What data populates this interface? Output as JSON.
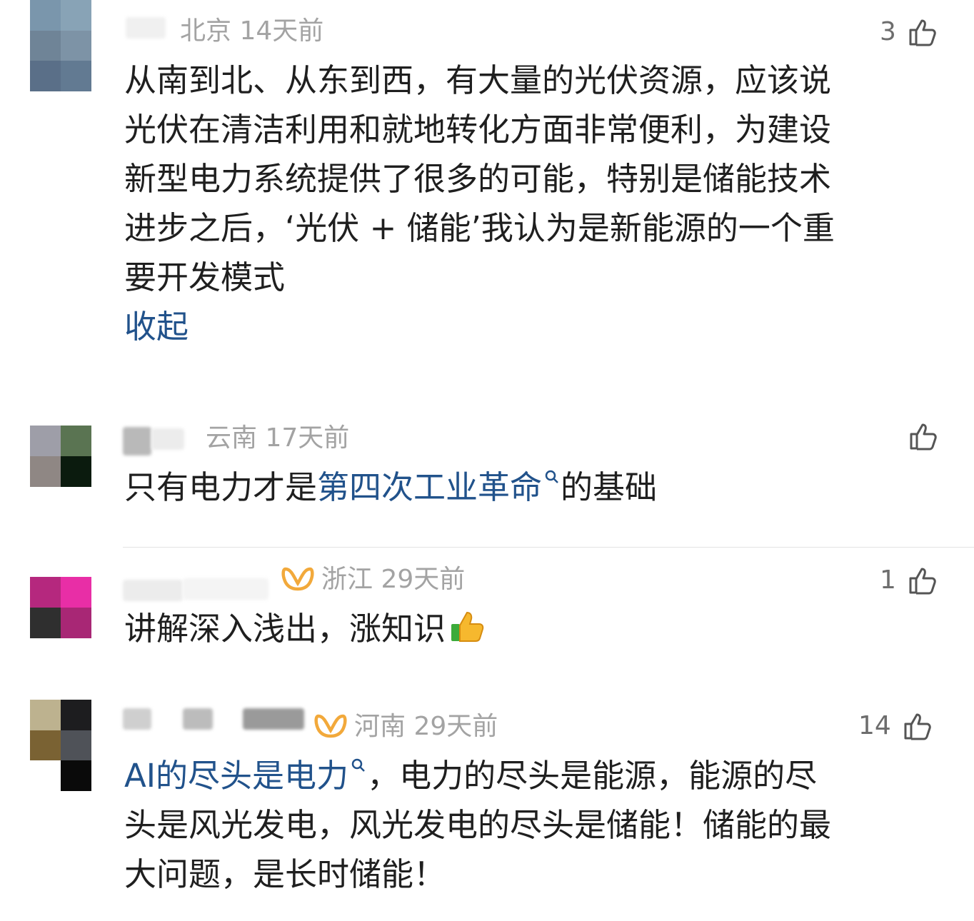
{
  "comments": [
    {
      "location_time": "北京 14天前",
      "likes": "3",
      "lines": [
        "从南到北、从东到西，有大量的光伏资源，应该说",
        "光伏在清洁利用和就地转化方面非常便利，为建设",
        "新型电力系统提供了很多的可能，特别是储能技术",
        "进步之后，‘光伏 + 储能’我认为是新能源的一个重",
        "要开发模式"
      ],
      "collapse_label": "收起",
      "avatar_colors": [
        "#7a96ac",
        "#88a3b6",
        "#6f8497",
        "#7d93a6",
        "#5a6f88",
        "#627a92"
      ]
    },
    {
      "location_time": "云南 17天前",
      "likes": "",
      "text_before": "只有电力才是",
      "link_text": "第四次工业革命",
      "text_after": "的基础",
      "avatar_colors": [
        "#9e9ea8",
        "#5a7452",
        "#8f8784",
        "#0b1b0e",
        "#ffffff",
        "#ffffff"
      ]
    },
    {
      "location_time": "浙江 29天前",
      "likes": "1",
      "text": "讲解深入浅出，涨知识",
      "emoji": "thumbs-up",
      "avatar_colors": [
        "#ffffff",
        "#ffffff",
        "#b5287e",
        "#e82ea6",
        "#2f2f2f",
        "#a82775"
      ]
    },
    {
      "location_time": "河南 29天前",
      "likes": "14",
      "link_text": "AI的尽头是电力",
      "lines": [
        "，电力的尽头是能源，能源的尽",
        "头是风光发电，风光发电的尽头是储能！储能的最",
        "大问题，是长时储能！"
      ],
      "avatar_colors": [
        "#bdb28f",
        "#1d1d1f",
        "#7a6233",
        "#4f5258",
        "#ffffff",
        "#0a0a0a"
      ]
    }
  ],
  "colors": {
    "link": "#21528b",
    "meta": "#a3a3a3",
    "vip_badge": "#f2a93b"
  }
}
